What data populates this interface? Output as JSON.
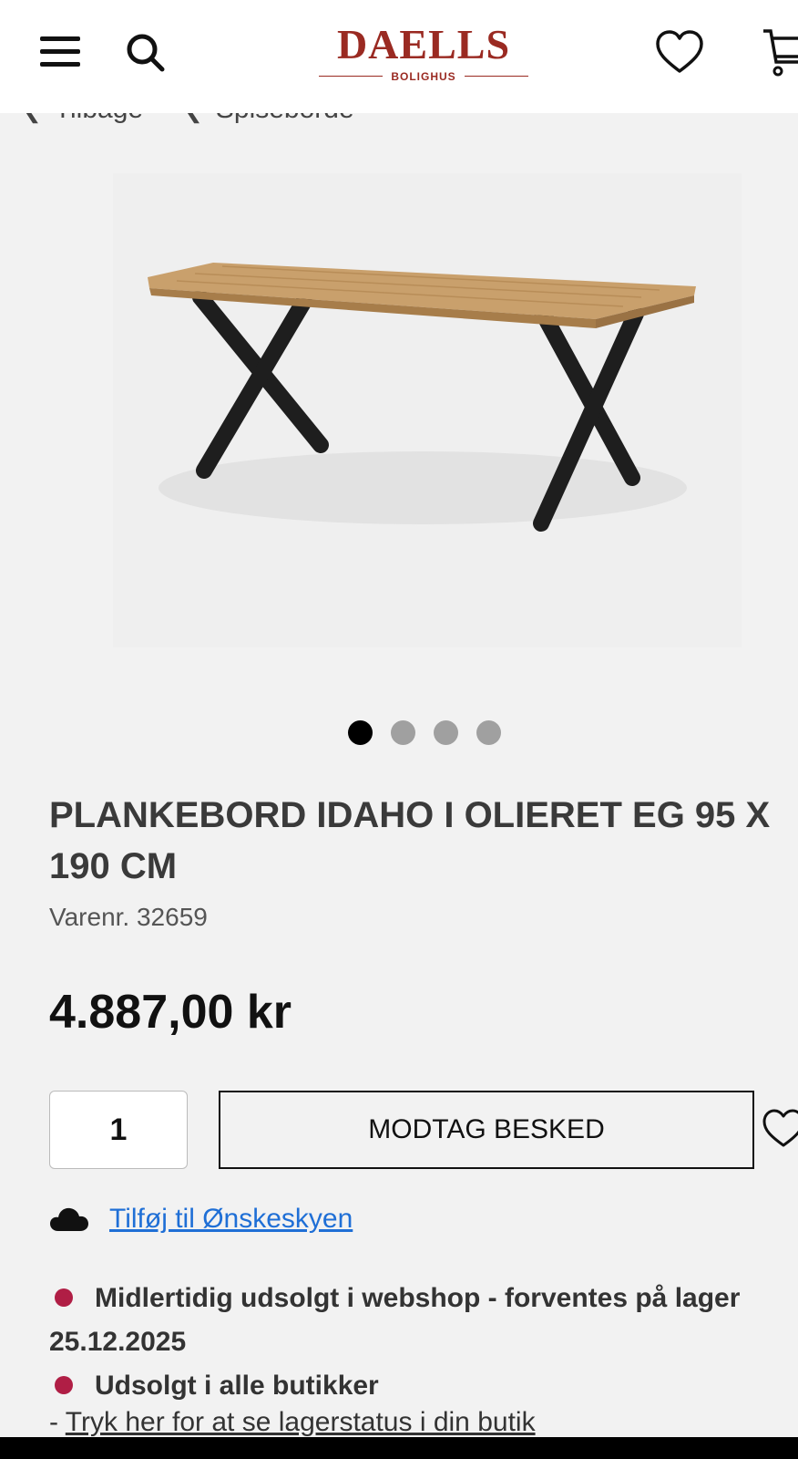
{
  "header": {
    "logo_main": "DAELLS",
    "logo_sub": "BOLIGHUS"
  },
  "breadcrumbs": [
    {
      "label": "Tilbage"
    },
    {
      "label": "Spiseborde"
    }
  ],
  "gallery": {
    "total_images": 4,
    "active_index": 0
  },
  "product": {
    "title": "PLANKEBORD IDAHO I OLIERET EG 95 X 190 CM",
    "sku": "Varenr. 32659",
    "price": "4.887,00 kr",
    "quantity": "1",
    "notify_button": "MODTAG BESKED"
  },
  "wishlist": {
    "link_text": "Tilføj til Ønskeskyen"
  },
  "stock": {
    "webshop_status": "Midlertidig udsolgt i webshop - forventes på lager 25.12.2025",
    "store_status": "Udsolgt i alle butikker",
    "store_link_prefix": "-",
    "store_link": "Tryk her for at se lagerstatus i din butik"
  },
  "colors": {
    "brand": "#9a2a22",
    "link": "#1f6fd6",
    "stock_indicator": "#b01e45"
  },
  "icons": [
    "menu-icon",
    "search-icon",
    "heart-icon",
    "cart-icon",
    "cloud-icon",
    "chevron-left-icon"
  ]
}
